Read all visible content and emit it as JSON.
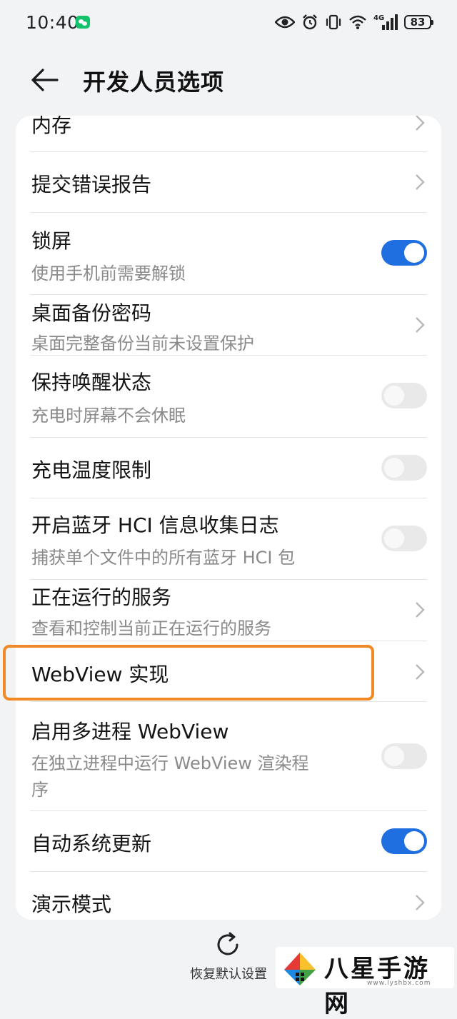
{
  "status_bar": {
    "time": "10:40",
    "battery": "83",
    "network_label": "4G",
    "icons": [
      "wechat-icon",
      "eye-icon",
      "alarm-icon",
      "vibrate-icon",
      "wifi-icon",
      "signal-icon",
      "battery-icon"
    ]
  },
  "header": {
    "title": "开发人员选项",
    "back_icon": "arrow-left-icon"
  },
  "settings": [
    {
      "title": "内存",
      "control": "chevron"
    },
    {
      "title": "提交错误报告",
      "control": "chevron"
    },
    {
      "title": "锁屏",
      "subtitle": "使用手机前需要解锁",
      "control": "toggle",
      "checked": true
    },
    {
      "title": "桌面备份密码",
      "subtitle": "桌面完整备份当前未设置保护",
      "control": "chevron"
    },
    {
      "title": "保持唤醒状态",
      "subtitle": "充电时屏幕不会休眠",
      "control": "toggle",
      "checked": false
    },
    {
      "title": "充电温度限制",
      "control": "toggle",
      "checked": false
    },
    {
      "title": "开启蓝牙 HCI 信息收集日志",
      "subtitle": "捕获单个文件中的所有蓝牙 HCI 包",
      "control": "toggle",
      "checked": false
    },
    {
      "title": "正在运行的服务",
      "subtitle": "查看和控制当前正在运行的服务",
      "control": "chevron"
    },
    {
      "title": "WebView 实现",
      "control": "chevron",
      "highlighted": true
    },
    {
      "title": "启用多进程 WebView",
      "subtitle_line1": "在独立进程中运行 WebView 渲染程",
      "subtitle_line2": "序",
      "control": "toggle",
      "checked": false
    },
    {
      "title": "自动系统更新",
      "control": "toggle",
      "checked": true
    },
    {
      "title": "演示模式",
      "control": "chevron"
    }
  ],
  "footer": {
    "reset_label": "恢复默认设置",
    "reset_icon": "refresh-icon"
  },
  "watermark": {
    "text": "八星手游网",
    "url": "www.lyshbx.com"
  },
  "colors": {
    "accent": "#1f6fe0",
    "highlight": "#f18a26",
    "background": "#f1f3f5",
    "card": "#ffffff"
  }
}
